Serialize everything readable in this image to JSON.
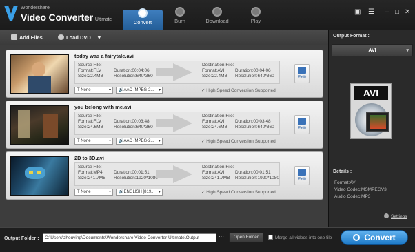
{
  "app": {
    "brand_small": "Wondershare",
    "brand_name": "Video Converter",
    "brand_suffix": "Ultimate"
  },
  "nav": {
    "tabs": [
      {
        "label": "Convert",
        "icon": "convert-icon",
        "active": true
      },
      {
        "label": "Burn",
        "icon": "burn-icon",
        "active": false
      },
      {
        "label": "Download",
        "icon": "download-icon",
        "active": false
      },
      {
        "label": "Play",
        "icon": "play-icon",
        "active": false
      }
    ]
  },
  "window_controls": {
    "chat": "▣",
    "menu": "☰",
    "minimize": "–",
    "maximize": "□",
    "close": "✕"
  },
  "toolbar": {
    "add_files": "Add Files",
    "load_dvd": "Load DVD",
    "dropdown": "▾"
  },
  "files": [
    {
      "title": "today was a fairytale.avi",
      "source_label": "Source File:",
      "source_format": "Format:FLV",
      "source_duration": "Duration:00:04:06",
      "source_size": "Size:22.4MB",
      "source_resolution": "Resolution:640*360",
      "dest_label": "Destination File:",
      "dest_format": "Format:AVI",
      "dest_duration": "Duration:00:04:06",
      "dest_size": "Size:22.4MB",
      "dest_resolution": "Resolution:640*360",
      "subtitle": "T None",
      "audio": "🔊AAC (MPEG-2...",
      "high_speed": "✓ High Speed Conversion Supported",
      "edit": "Edit"
    },
    {
      "title": "you belong with me.avi",
      "source_label": "Source File:",
      "source_format": "Format:FLV",
      "source_duration": "Duration:00:03:48",
      "source_size": "Size:24.6MB",
      "source_resolution": "Resolution:640*360",
      "dest_label": "Destination File:",
      "dest_format": "Format:AVI",
      "dest_duration": "Duration:00:03:48",
      "dest_size": "Size:24.6MB",
      "dest_resolution": "Resolution:640*360",
      "subtitle": "T None",
      "audio": "🔊AAC (MPEG-2...",
      "high_speed": "✓ High Speed Conversion Supported",
      "edit": "Edit"
    },
    {
      "title": "2D to 3D.avi",
      "source_label": "Source File:",
      "source_format": "Format:MP4",
      "source_duration": "Duration:00:01:51",
      "source_size": "Size:241.7MB",
      "source_resolution": "Resolution:1920*1080",
      "dest_label": "Destination File:",
      "dest_format": "Format:AVI",
      "dest_duration": "Duration:00:01:51",
      "dest_size": "Size:241.7MB",
      "dest_resolution": "Resolution:1920*1080",
      "subtitle": "T None",
      "audio": "🔊ENGLISH [819...",
      "high_speed": "✓ High Speed Conversion Supported",
      "edit": "Edit"
    }
  ],
  "output_panel": {
    "title": "Output Format :",
    "format": "AVI",
    "badge": "AVI",
    "details_title": "Details :",
    "details": [
      "Format:AVI",
      "Video Codec:MSMPEGV3",
      "Audio Codec:MP3"
    ],
    "settings": "Settings"
  },
  "bottom": {
    "output_folder_label": "Output Folder :",
    "output_path": "C:\\Users\\zhouying\\Documents\\Wondershare Video Converter Ultimate\\Output",
    "dots": "···",
    "open_folder": "Open Folder",
    "merge": "Merge all videos into one file",
    "convert": "Convert"
  }
}
